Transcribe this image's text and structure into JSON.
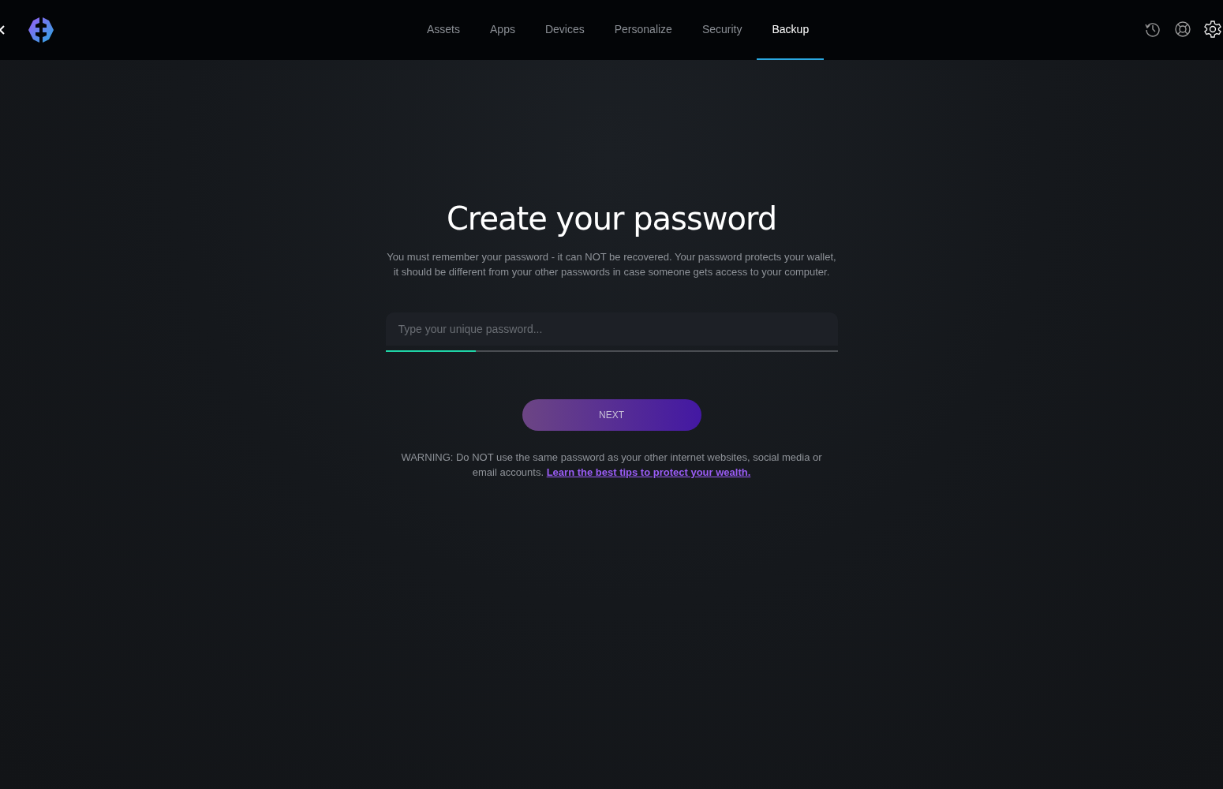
{
  "nav": {
    "tabs": [
      {
        "label": "Assets",
        "selected": false
      },
      {
        "label": "Apps",
        "selected": false
      },
      {
        "label": "Devices",
        "selected": false
      },
      {
        "label": "Personalize",
        "selected": false
      },
      {
        "label": "Security",
        "selected": false
      },
      {
        "label": "Backup",
        "selected": true
      }
    ]
  },
  "title": "Create your password",
  "description": "You must remember your password - it can NOT be recovered. Your password protects your wallet, it should be different from your other passwords in case someone gets access to your computer.",
  "password_field": {
    "placeholder": "Type your unique password..."
  },
  "strength_meter": {
    "level": 0.2
  },
  "next_button": "NEXT",
  "warning": "WARNING: Do NOT use the same password as your other internet websites, social media or email accounts.",
  "warning_link": "Learn the best tips to protect your wealth."
}
